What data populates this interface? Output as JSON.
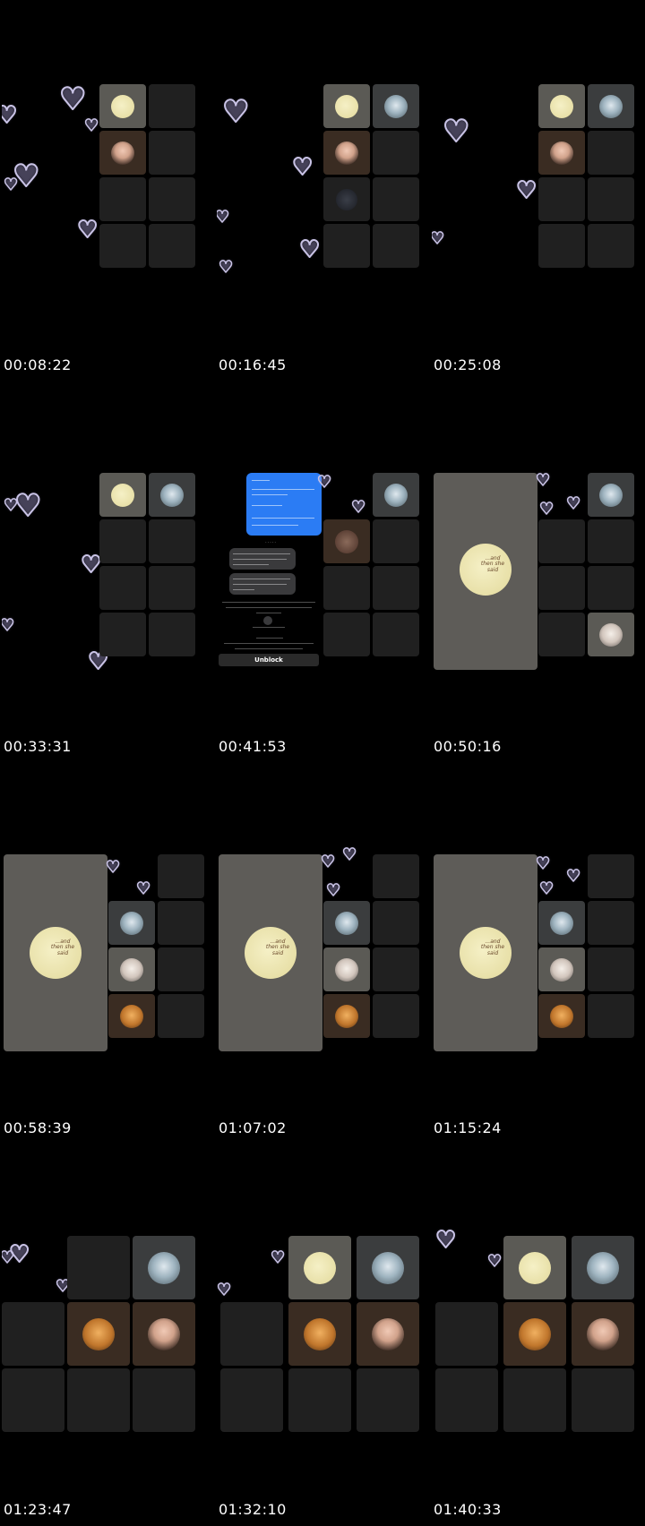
{
  "timestamps": [
    "00:08:22",
    "00:16:45",
    "00:25:08",
    "00:33:31",
    "00:41:53",
    "00:50:16",
    "00:58:39",
    "01:07:02",
    "01:15:24",
    "01:23:47",
    "01:32:10",
    "01:40:33"
  ],
  "icons": {
    "heart": "heart-outline-icon",
    "moon": "moon-avatar-icon",
    "cat": "cat-avatar-icon",
    "girl": "girl-avatar-icon",
    "dog": "dog-avatar-icon",
    "anime": "anime-avatar-icon"
  },
  "post_caption": "...and then she said",
  "chat": {
    "unblock_label": "Unblock"
  },
  "colors": {
    "background": "#000000",
    "tile": "#202020",
    "chat_blue": "#2b7cf4",
    "heart_outline": "#c9c3e6"
  }
}
